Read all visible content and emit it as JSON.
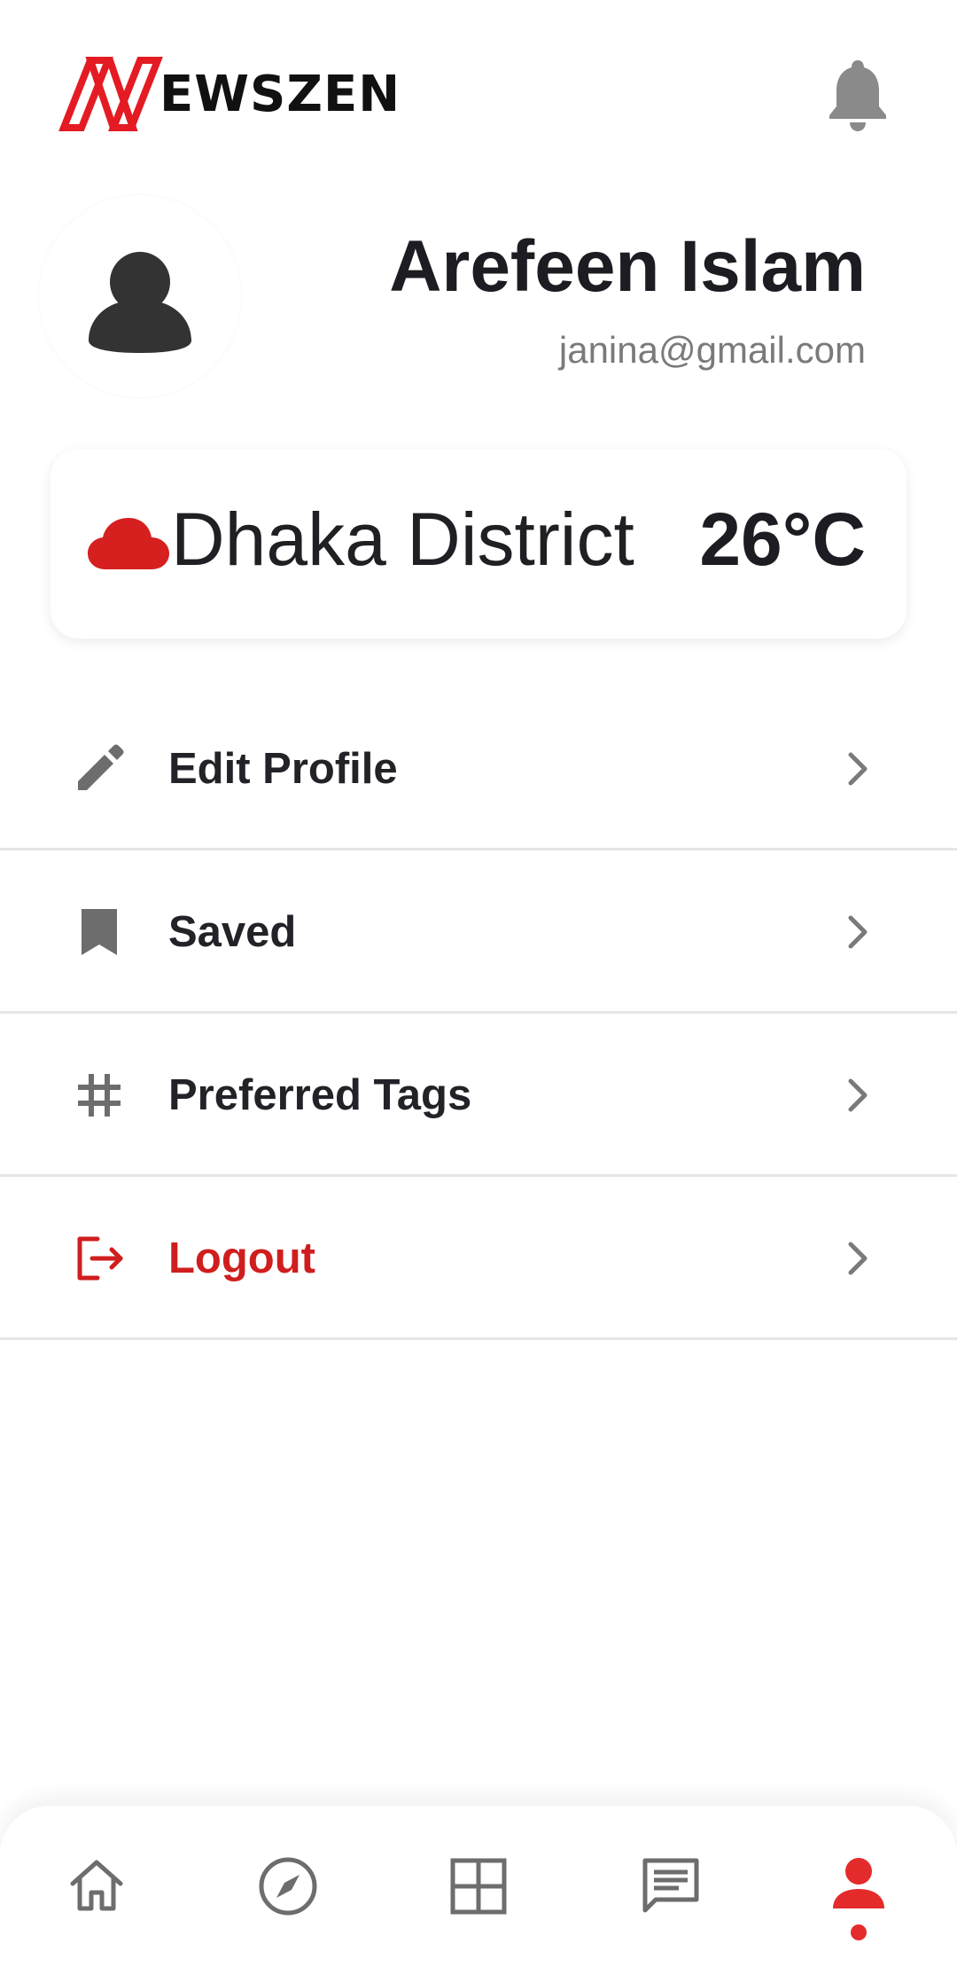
{
  "app": {
    "brand": "EWSZEN",
    "logo_letter": "N"
  },
  "profile": {
    "name": "Arefeen Islam",
    "email": "janina@gmail.com"
  },
  "weather": {
    "location": "Dhaka District",
    "temperature": "26°C",
    "icon": "cloud-icon"
  },
  "menu": {
    "items": [
      {
        "label": "Edit Profile",
        "icon": "pencil-icon"
      },
      {
        "label": "Saved",
        "icon": "bookmark-icon"
      },
      {
        "label": "Preferred Tags",
        "icon": "hashtag-icon"
      },
      {
        "label": "Logout",
        "icon": "logout-icon"
      }
    ]
  },
  "bottom_nav": {
    "items": [
      {
        "icon": "home-icon",
        "active": false
      },
      {
        "icon": "compass-icon",
        "active": false
      },
      {
        "icon": "grid-icon",
        "active": false
      },
      {
        "icon": "chat-icon",
        "active": false
      },
      {
        "icon": "person-icon",
        "active": true
      }
    ]
  },
  "colors": {
    "accent": "#e32b2b",
    "logout": "#d01e1e",
    "icon_gray": "#707070",
    "text_dark": "#1f1f24"
  }
}
